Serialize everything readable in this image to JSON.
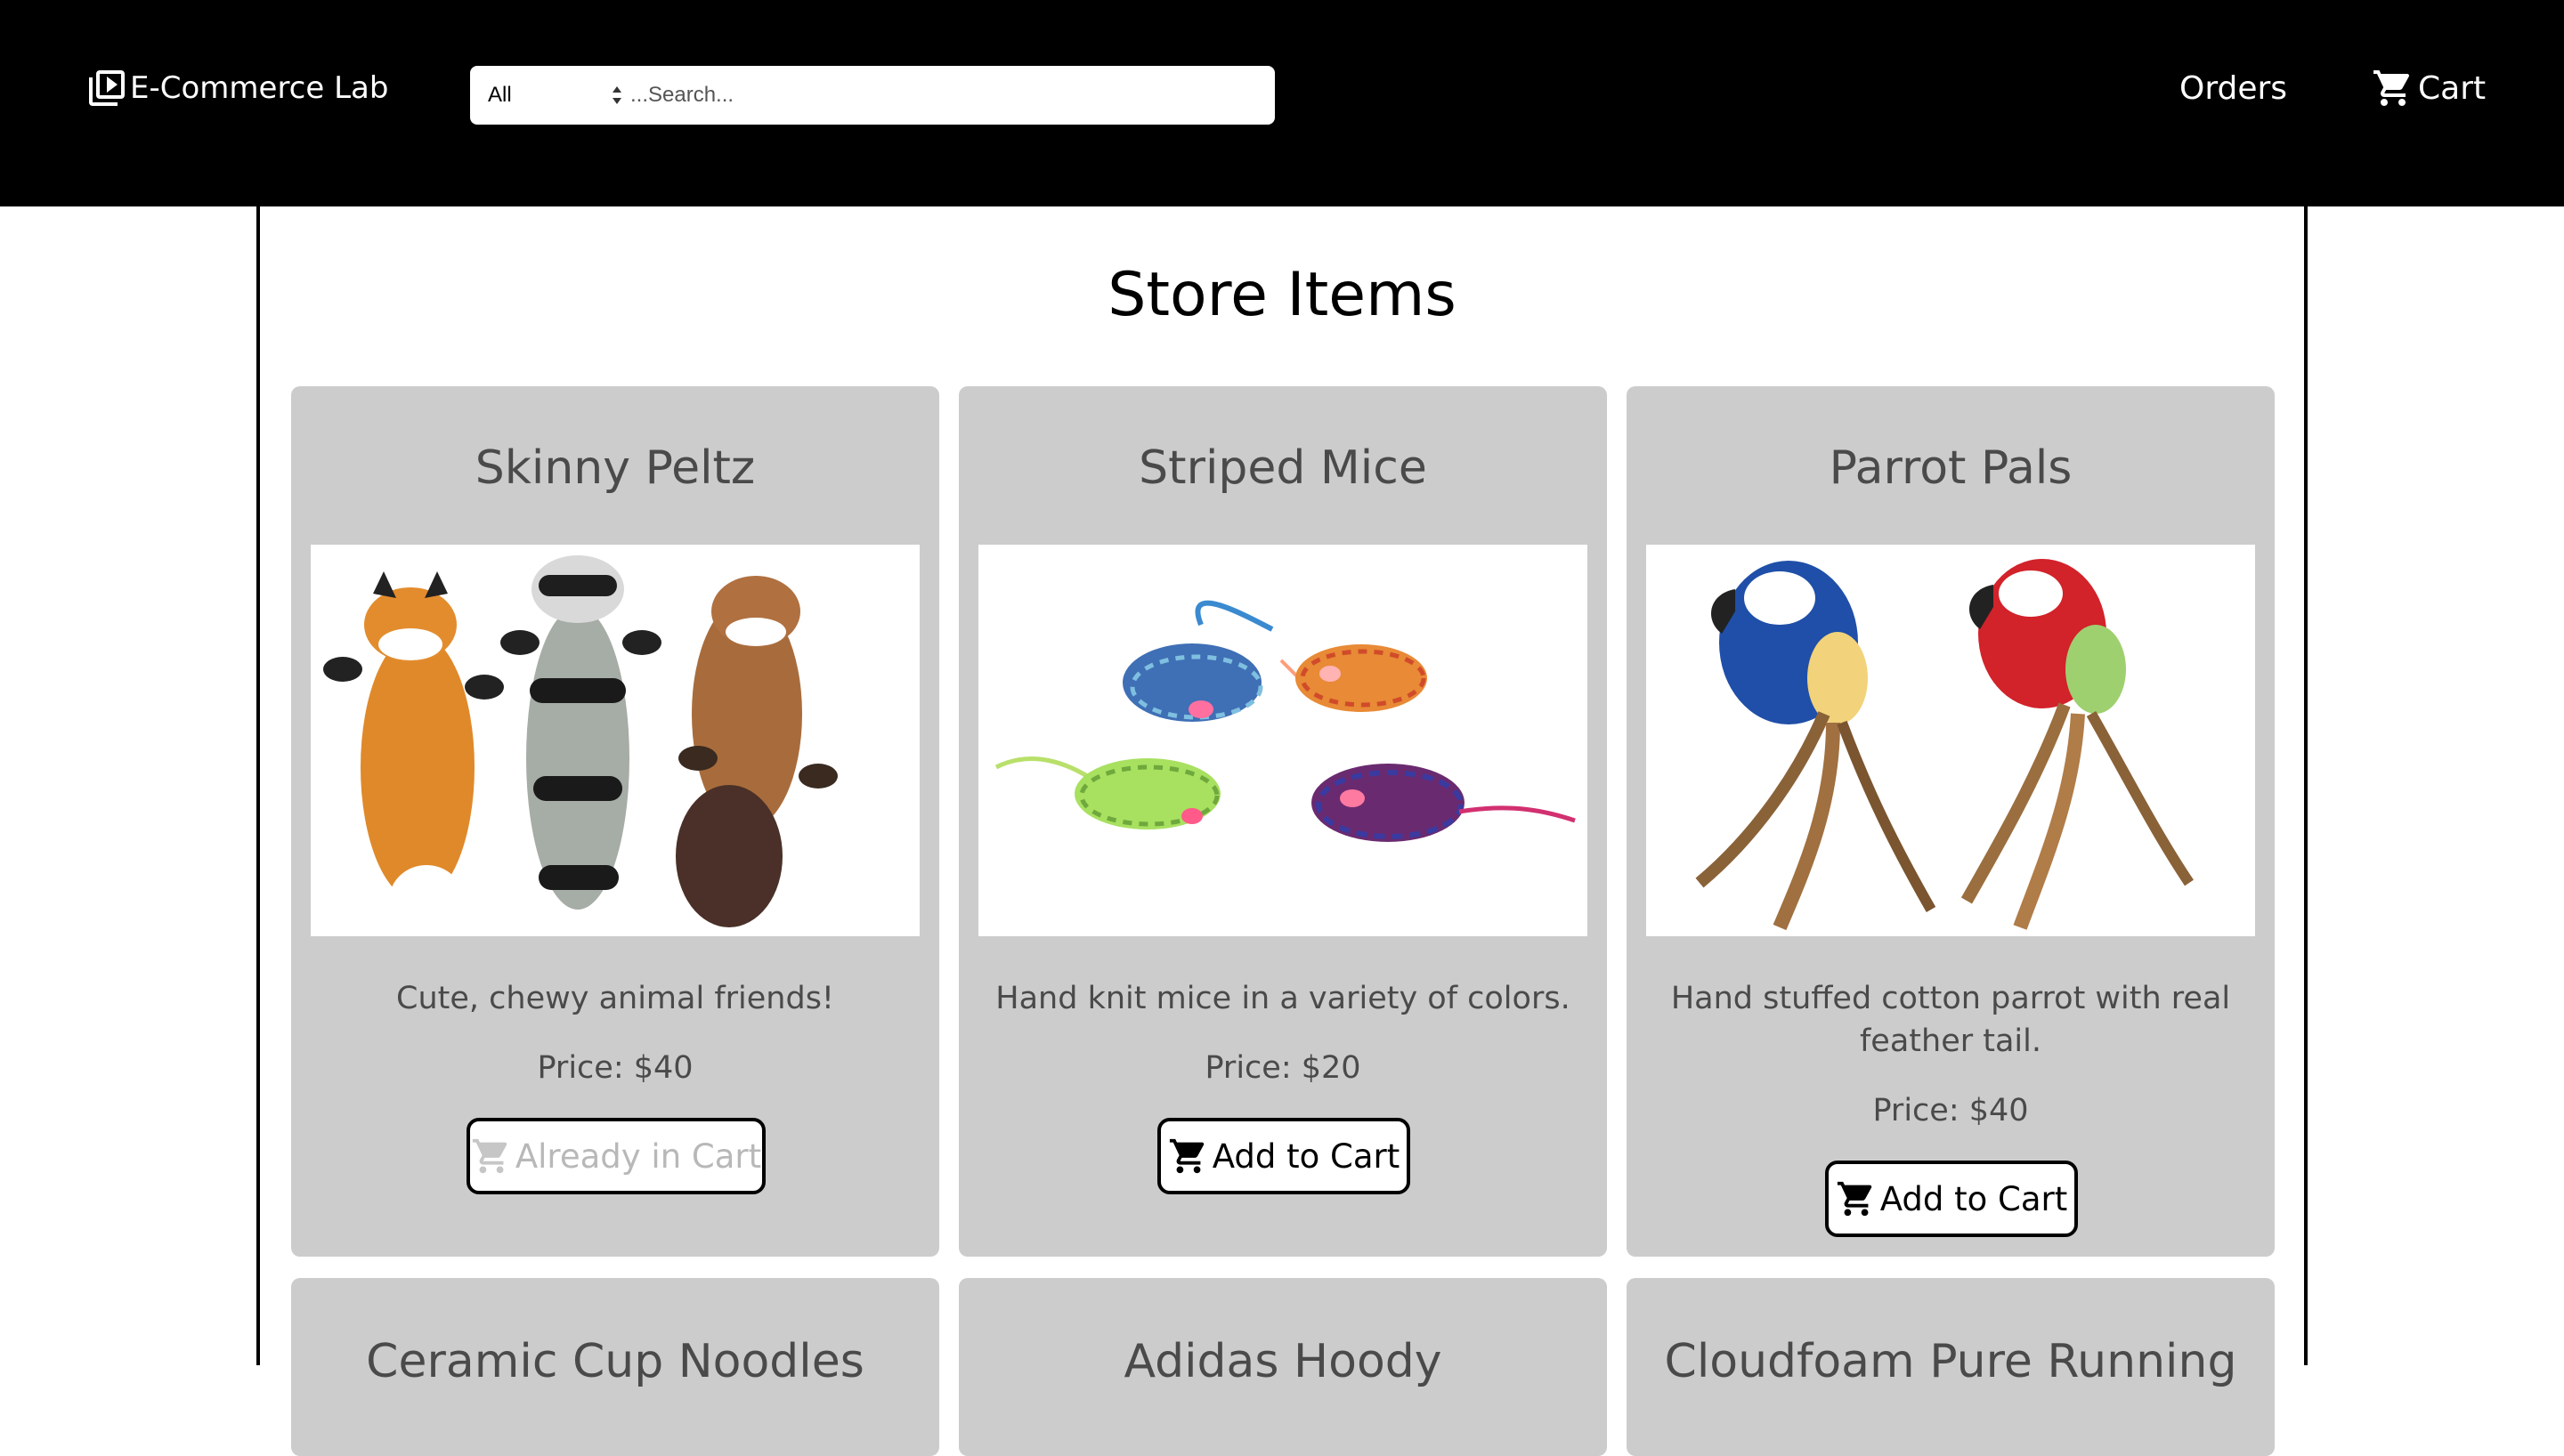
{
  "navbar": {
    "brand_label": "E-Commerce Lab",
    "category_select_value": "All",
    "search_placeholder": "...Search...",
    "orders_label": "Orders",
    "cart_label": "Cart",
    "brand_icon": "video-library-icon",
    "cart_icon": "shopping-cart-icon"
  },
  "main": {
    "title": "Store Items",
    "products": [
      {
        "name": "Skinny Peltz",
        "description": "Cute, chewy animal friends!",
        "price": "Price: $40",
        "button_label": "Already in Cart",
        "in_cart": true
      },
      {
        "name": "Striped Mice",
        "description": "Hand knit mice in a variety of colors.",
        "price": "Price: $20",
        "button_label": "Add to Cart",
        "in_cart": false
      },
      {
        "name": "Parrot Pals",
        "description": "Hand stuffed cotton parrot with real feather tail.",
        "price": "Price: $40",
        "button_label": "Add to Cart",
        "in_cart": false
      }
    ],
    "next_row_titles": [
      "Ceramic Cup Noodles",
      "Adidas Hoody",
      "Cloudfoam Pure Running"
    ]
  },
  "colors": {
    "navbar_bg": "#000000",
    "card_bg": "#cccccc",
    "text_muted": "#4a4a4a",
    "disabled_text": "#b8b8b8"
  }
}
